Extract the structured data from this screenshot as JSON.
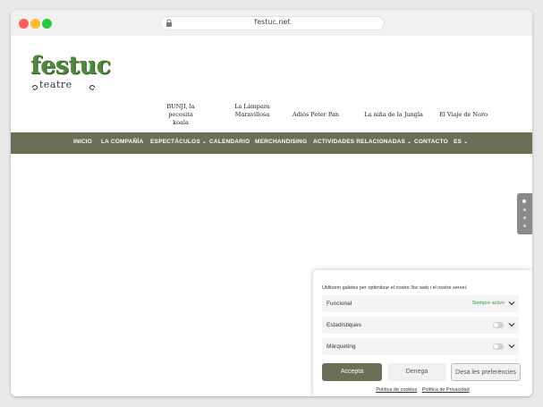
{
  "browser": {
    "url": "festuc.net"
  },
  "logo": {
    "main": "festuc",
    "sub": "teatre"
  },
  "shows": [
    {
      "line1": "BUNJI, la pecosita",
      "line2": "koala"
    },
    {
      "line1": "La Lámpara",
      "line2": "Maravillosa"
    },
    {
      "line1": "Adiós Peter Pan",
      "line2": ""
    },
    {
      "line1": "La niña de la Jungla",
      "line2": ""
    },
    {
      "line1": "El Viaje de Noro",
      "line2": ""
    }
  ],
  "nav": {
    "items": [
      {
        "label": "INICIO"
      },
      {
        "label": "LA COMPAÑÍA"
      },
      {
        "label": "ESPECTÁCULOS",
        "chevron": "⌄"
      },
      {
        "label": "CALENDARIO"
      },
      {
        "label": "MERCHANDISING"
      },
      {
        "label": "ACTIVIDADES RELACIONADAS",
        "chevron": "⌄"
      },
      {
        "label": "CONTACTO"
      },
      {
        "label": "ES",
        "chevron": "⌄"
      }
    ]
  },
  "side_nav": {
    "count": 4,
    "active_index": 0
  },
  "consent": {
    "intro": "Utilitzem galetes per optimitzar el nostre lloc web i el nostre servei.",
    "categories": [
      {
        "label": "Funcional",
        "status": "Siempre activo"
      },
      {
        "label": "Estadístiques",
        "status": ""
      },
      {
        "label": "Màrqueting",
        "status": ""
      }
    ],
    "accept_label": "Accepta",
    "deny_label": "Denega",
    "prefs_label": "Desa les preferències",
    "cookie_policy": "Política de cookies",
    "privacy_policy": "Política de Privacidad"
  },
  "colors": {
    "nav_bg": "#6b6f55",
    "logo_green": "#4e8a3c",
    "status_green": "#2f9e44"
  }
}
